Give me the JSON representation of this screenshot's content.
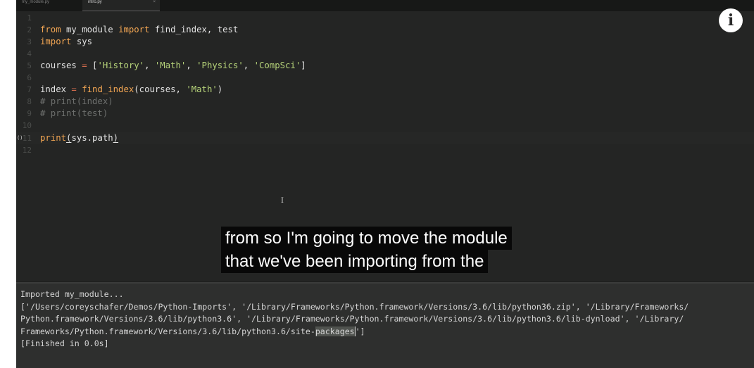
{
  "tabs": [
    {
      "label": "my_module.py",
      "close": "×"
    },
    {
      "label": "intro.py",
      "close": "×"
    }
  ],
  "editor": {
    "gutter": [
      "1",
      "2",
      "3",
      "4",
      "5",
      "6",
      "7",
      "8",
      "9",
      "10",
      "11",
      "12"
    ],
    "breakpoint_marker": "()",
    "lines": {
      "l2": {
        "a": "from",
        "b": " my_module ",
        "c": "import",
        "d": " find_index, test"
      },
      "l3": {
        "a": "import",
        "b": " sys"
      },
      "l5": {
        "a": "courses ",
        "b": "=",
        "c": " [",
        "d": "'History'",
        "e": ", ",
        "f": "'Math'",
        "g": ", ",
        "h": "'Physics'",
        "i": ", ",
        "j": "'CompSci'",
        "k": "]"
      },
      "l7": {
        "a": "index ",
        "b": "=",
        "c": " ",
        "d": "find_index",
        "e": "(courses, ",
        "f": "'Math'",
        "g": ")"
      },
      "l8": "# print(index)",
      "l9": "# print(test)",
      "l11": {
        "a": "print",
        "b": "(",
        "c": "sys.path",
        "d": ")"
      }
    },
    "cursor_glyph": "I"
  },
  "info_icon_label": "i",
  "captions": {
    "line1": "from so I'm going to move the module",
    "line2": "that we've been importing from the"
  },
  "output": {
    "line1": "Imported my_module...",
    "line2": "['/Users/coreyschafer/Demos/Python-Imports', '/Library/Frameworks/Python.framework/Versions/3.6/lib/python36.zip', '/Library/Frameworks/",
    "line3": "Python.framework/Versions/3.6/lib/python3.6', '/Library/Frameworks/Python.framework/Versions/3.6/lib/python3.6/lib-dynload', '/Library/",
    "line4_a": "Frameworks/Python.framework/Versions/3.6/lib/python3.6/site-",
    "line4_b": "packages",
    "line4_c": "']",
    "line5": "[Finished in 0.0s]"
  }
}
